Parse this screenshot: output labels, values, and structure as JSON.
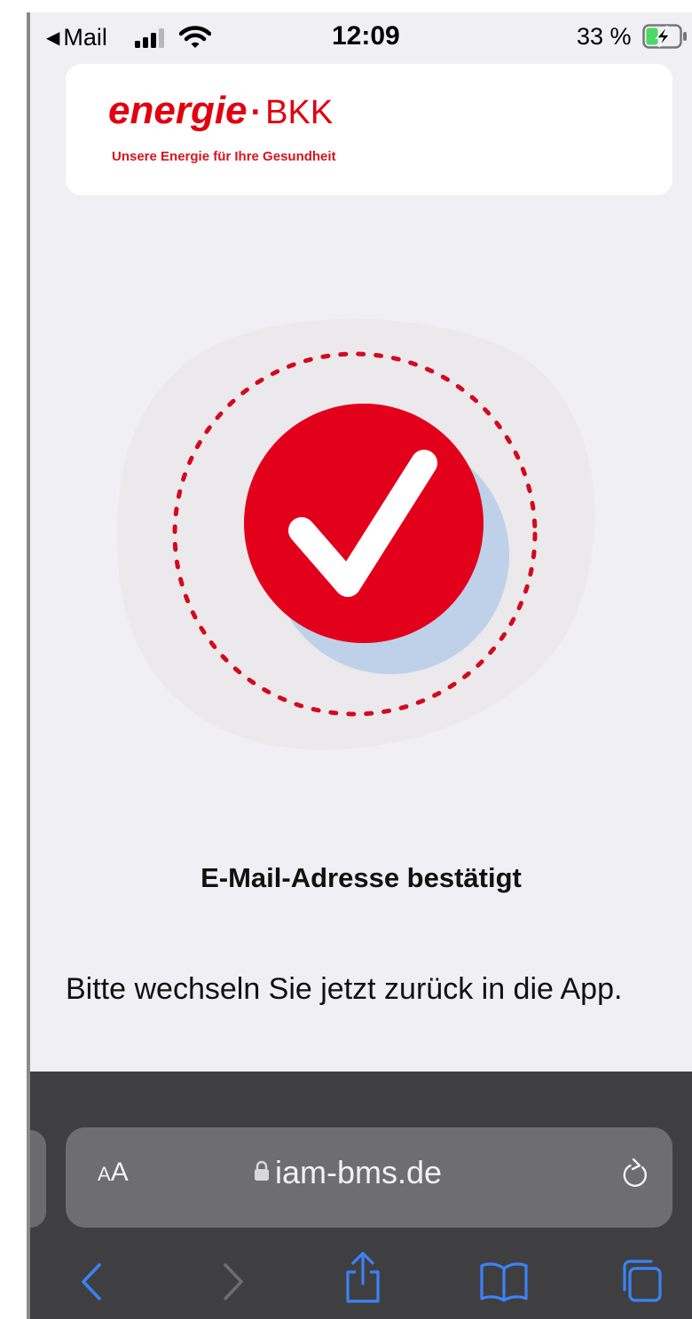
{
  "status_bar": {
    "back_app": "Mail",
    "back_glyph": "◀",
    "time": "12:09",
    "battery": "33 %",
    "icons": [
      "signal-icon",
      "wifi-icon",
      "battery-charging-icon"
    ]
  },
  "logo": {
    "energie": "energie",
    "separator": "·",
    "bkk": "BKK",
    "tagline": "Unsere Energie für Ihre Gesundheit",
    "brand_color": "#e1000f"
  },
  "illustration": {
    "icon": "checkmark-circle-icon",
    "circle_color": "#e2001a",
    "shadow_color": "#bfd1e9",
    "ring_color": "#d10a1e"
  },
  "content": {
    "title": "E-Mail-Adresse bestätigt",
    "body": "Bitte wechseln Sie jetzt zurück in die App."
  },
  "browser": {
    "reader_small": "A",
    "reader_big": "A",
    "url": "iam-bms.de",
    "icons": [
      "lock-icon",
      "reload-icon",
      "back-icon",
      "forward-icon",
      "share-icon",
      "bookmarks-icon",
      "tabs-icon"
    ],
    "accent_color": "#3b82f6"
  }
}
